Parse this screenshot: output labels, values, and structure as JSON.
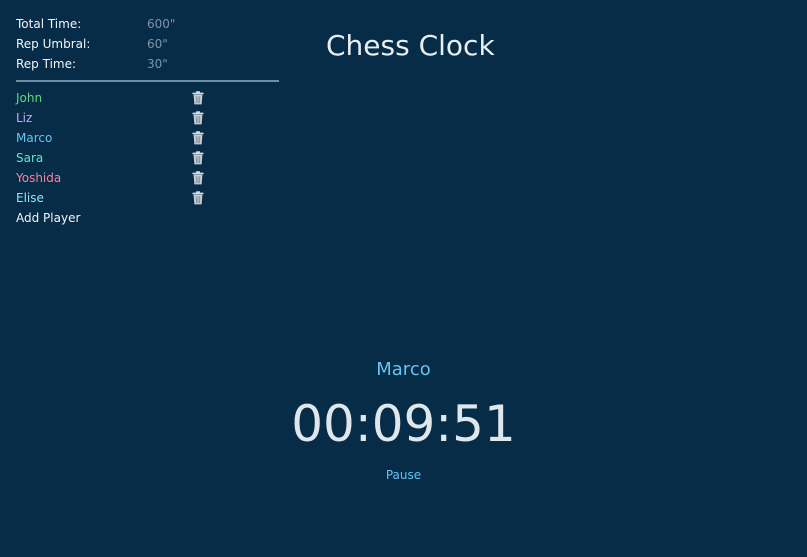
{
  "settings": {
    "total_time": {
      "label": "Total Time:",
      "value": "600\""
    },
    "rep_umbral": {
      "label": "Rep Umbral:",
      "value": "60\""
    },
    "rep_time": {
      "label": "Rep Time:",
      "value": "30\""
    }
  },
  "players": [
    {
      "name": "John",
      "color": "#5bd982",
      "icon": "trash-icon"
    },
    {
      "name": "Liz",
      "color": "#c7a6ff",
      "icon": "trash-icon"
    },
    {
      "name": "Marco",
      "color": "#66c3f2",
      "icon": "trash-icon"
    },
    {
      "name": "Sara",
      "color": "#5ee8c8",
      "icon": "trash-icon"
    },
    {
      "name": "Yoshida",
      "color": "#ff7f9c",
      "icon": "trash-icon"
    },
    {
      "name": "Elise",
      "color": "#8de6ff",
      "icon": "trash-icon"
    }
  ],
  "add_player_label": "Add Player",
  "title": "Chess Clock",
  "clock": {
    "current_player": "Marco",
    "time": "00:09:51",
    "pause_label": "Pause"
  },
  "colors": {
    "background": "#062c48",
    "accent": "#66c3f2"
  }
}
